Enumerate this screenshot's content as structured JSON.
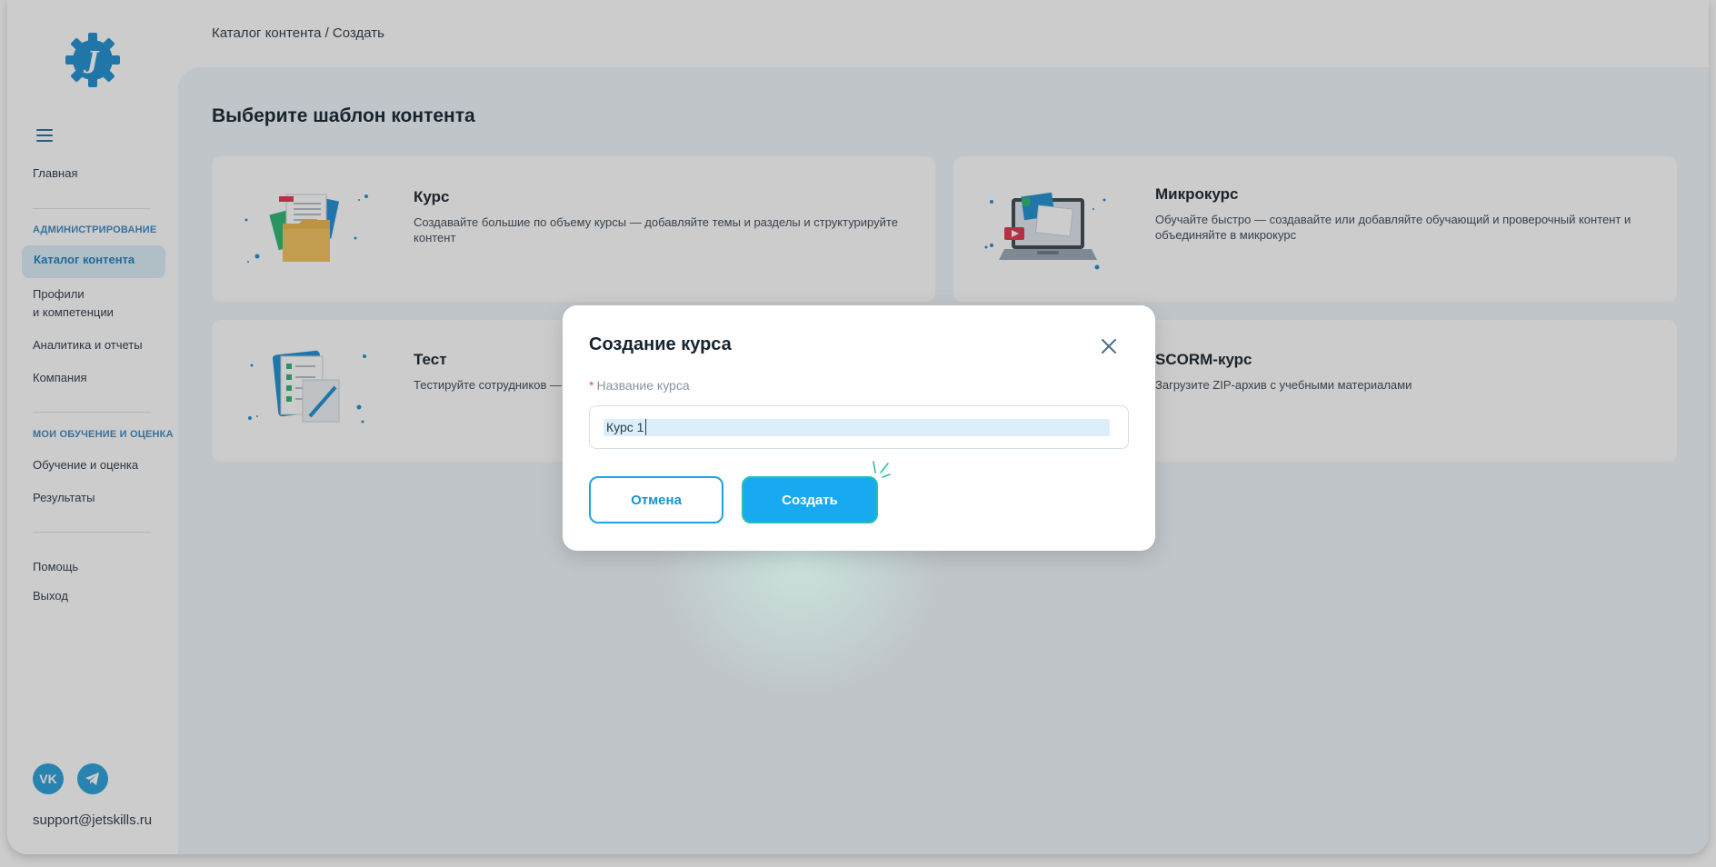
{
  "colors": {
    "accent": "#17aaf0",
    "brand": "#1a7fc1",
    "sidebar_active_bg": "#dbeef8",
    "content_bg": "#eef6fb",
    "overlay": "rgba(40,40,40,0.24)"
  },
  "sidebar": {
    "logo": "jetskills-gear-logo",
    "menu_icon": "hamburger-icon",
    "home_label": "Главная",
    "admin_section": "АДМИНИСТРИРОВАНИЕ",
    "admin_items": {
      "catalog": "Каталог контента",
      "profiles_line1": "Профили",
      "profiles_line2": "и компетенции",
      "analytics": "Аналитика и отчеты",
      "company": "Компания"
    },
    "learning_section": "МОИ ОБУЧЕНИЕ И ОЦЕНКА",
    "learning_items": {
      "learning": "Обучение и оценка",
      "results": "Результаты"
    },
    "help": "Помощь",
    "logout": "Выход",
    "social": {
      "vk": "VK",
      "vk_icon": "vk-icon",
      "telegram_icon": "telegram-icon"
    },
    "support_email": "support@jetskills.ru"
  },
  "header": {
    "breadcrumb": "Каталог контента / Создать",
    "avatar": "user-avatar"
  },
  "main": {
    "title": "Выберите шаблон контента",
    "cards": [
      {
        "title": "Курс",
        "description": "Создавайте большие по объему курсы — добавляйте темы и разделы и структурируйте контент",
        "icon": "folder-documents-illustration"
      },
      {
        "title": "Микрокурс",
        "description": "Обучайте быстро — создавайте или добавляйте обучающий и проверочный контент и объединяйте в микрокурс",
        "icon": "laptop-illustration"
      },
      {
        "title": "Тест",
        "description": "Тестируйте сотрудников —",
        "icon": "checklist-illustration"
      },
      {
        "title": "SCORM-курс",
        "description": "Загрузите ZIP-архив с учебными материалами",
        "icon": "scorm-illustration"
      }
    ]
  },
  "modal": {
    "title": "Создание курса",
    "close_icon": "close-icon",
    "field_required_mark": "*",
    "field_label": "Название курса",
    "field_value": "Курс 1",
    "cancel_label": "Отмена",
    "create_label": "Создать"
  }
}
